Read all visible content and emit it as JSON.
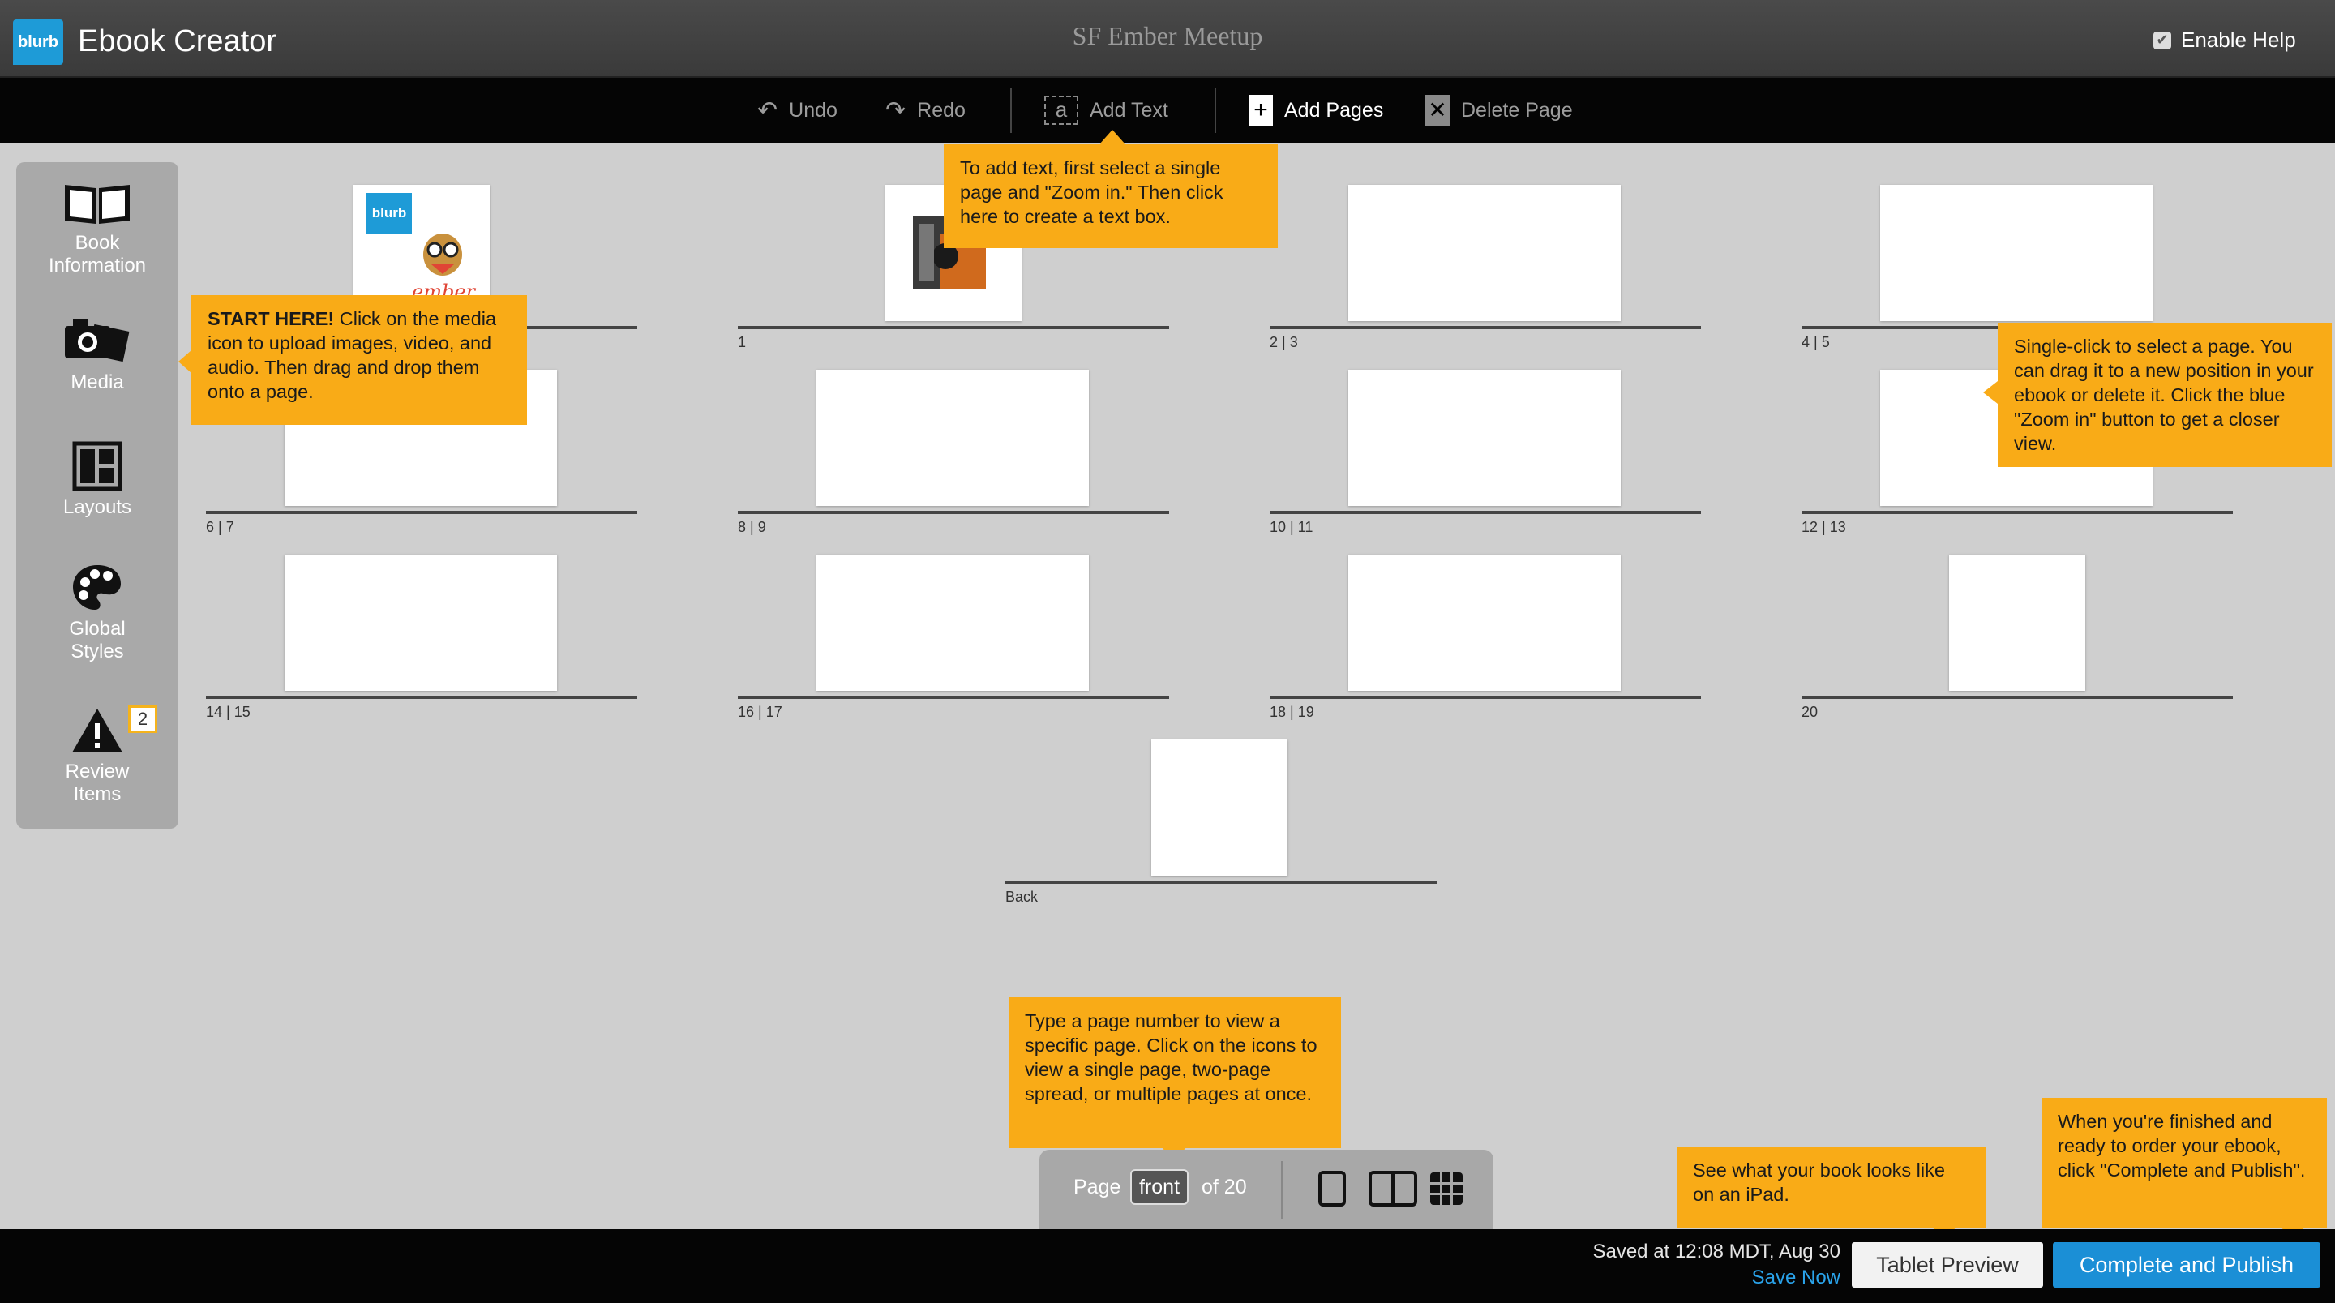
{
  "app": {
    "logo_text": "blurb",
    "title": "Ebook Creator",
    "book_title": "SF Ember Meetup",
    "help_label": "Enable Help",
    "help_checked": true
  },
  "toolbar": {
    "undo": "Undo",
    "redo": "Redo",
    "add_text": "Add Text",
    "add_pages": "Add Pages",
    "delete_page": "Delete Page"
  },
  "sidebar": {
    "items": [
      {
        "label_line1": "Book",
        "label_line2": "Information",
        "icon": "book-icon"
      },
      {
        "label_line1": "Media",
        "label_line2": "",
        "icon": "camera-icon"
      },
      {
        "label_line1": "Layouts",
        "label_line2": "",
        "icon": "layout-icon"
      },
      {
        "label_line1": "Global",
        "label_line2": "Styles",
        "icon": "palette-icon"
      },
      {
        "label_line1": "Review",
        "label_line2": "Items",
        "icon": "warning-icon",
        "badge": "2"
      }
    ]
  },
  "pages": {
    "labels": [
      "1",
      "2 | 3",
      "4 | 5",
      "6 | 7",
      "8 | 9",
      "10 | 11",
      "12 | 13",
      "14 | 15",
      "16 | 17",
      "18 | 19",
      "20",
      "Back"
    ],
    "cover_logo_text": "blurb",
    "cover_brand_text": "ember"
  },
  "tips": {
    "start_bold": "START HERE!",
    "start": " Click on the media icon to upload images, video, and audio. Then drag and drop them onto a page.",
    "add_text": "To add text, first select a single page and \"Zoom in.\" Then click here to create a text box.",
    "select": "Single-click to select a page. You can drag it to a new position in your ebook or delete it. Click the blue \"Zoom in\" button to get a closer view.",
    "pagenav": "Type a page number to view a specific page. Click on the icons to view a single page, two-page spread, or multiple pages at once.",
    "tablet": "See what your book looks like on an iPad.",
    "publish": "When you're finished and ready to order your ebook, click \"Complete and Publish\"."
  },
  "pagenav": {
    "page_label": "Page",
    "current": "front",
    "of_label": "of 20"
  },
  "footer": {
    "saved_text": "Saved at 12:08 MDT, Aug 30",
    "save_now": "Save Now",
    "tablet_preview": "Tablet Preview",
    "complete_publish": "Complete and Publish"
  },
  "colors": {
    "accent_blue": "#1e9bd7",
    "tooltip": "#f9ab17",
    "publish_button": "#1b8fd6"
  }
}
